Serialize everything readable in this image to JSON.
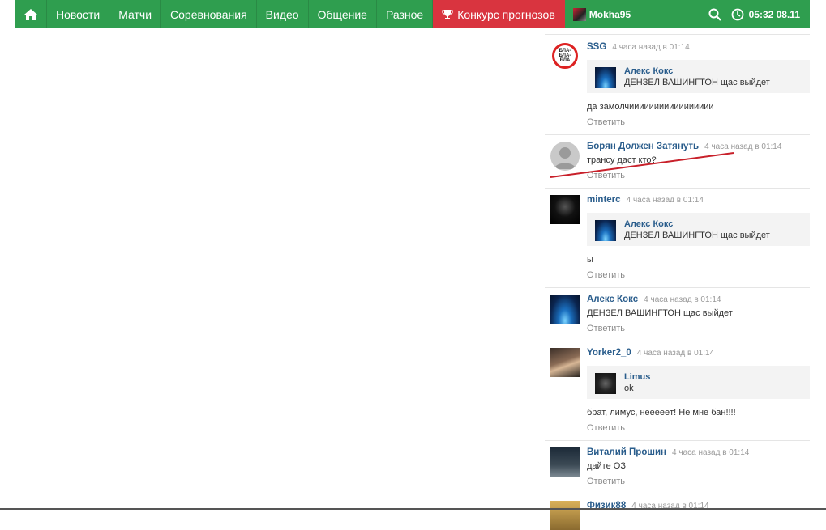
{
  "nav": {
    "items": [
      {
        "label": "Новости"
      },
      {
        "label": "Матчи"
      },
      {
        "label": "Соревнования"
      },
      {
        "label": "Видео"
      },
      {
        "label": "Общение"
      },
      {
        "label": "Разное"
      }
    ],
    "contest_label": "Конкурс прогнозов",
    "username": "Mokha95",
    "time": "05:32 08.11",
    "colors": {
      "bar": "#2f9e4f",
      "contest": "#d9343f"
    }
  },
  "comments": [
    {
      "author": "SSG",
      "time": "4 часа назад в 01:14",
      "quote": {
        "author": "Алекс Кокс",
        "text": "ДЕНЗЕЛ ВАШИНГТОН щас выйдет"
      },
      "text": "да замолчиииииииииииииииии",
      "reply": "Ответить",
      "avatar_text": "БЛА-БЛА-БЛА"
    },
    {
      "author": "Борян Должен Затянуть",
      "time": "4 часа назад в 01:14",
      "text": "трансу даст кто?",
      "reply": "Ответить"
    },
    {
      "author": "minterc",
      "time": "4 часа назад в 01:14",
      "quote": {
        "author": "Алекс Кокс",
        "text": "ДЕНЗЕЛ ВАШИНГТОН щас выйдет"
      },
      "text": "ы",
      "reply": "Ответить"
    },
    {
      "author": "Алекс Кокс",
      "time": "4 часа назад в 01:14",
      "text": "ДЕНЗЕЛ ВАШИНГТОН щас выйдет",
      "reply": "Ответить"
    },
    {
      "author": "Yorker2_0",
      "time": "4 часа назад в 01:14",
      "quote": {
        "author": "Limus",
        "text": "ok"
      },
      "text": "брат, лимус, неееeeт! Не мне бан!!!!",
      "reply": "Ответить"
    },
    {
      "author": "Виталий Прошин",
      "time": "4 часа назад в 01:14",
      "text": "дайте ОЗ",
      "reply": "Ответить"
    },
    {
      "author": "Физик88",
      "time": "4 часа назад в 01:14"
    }
  ]
}
